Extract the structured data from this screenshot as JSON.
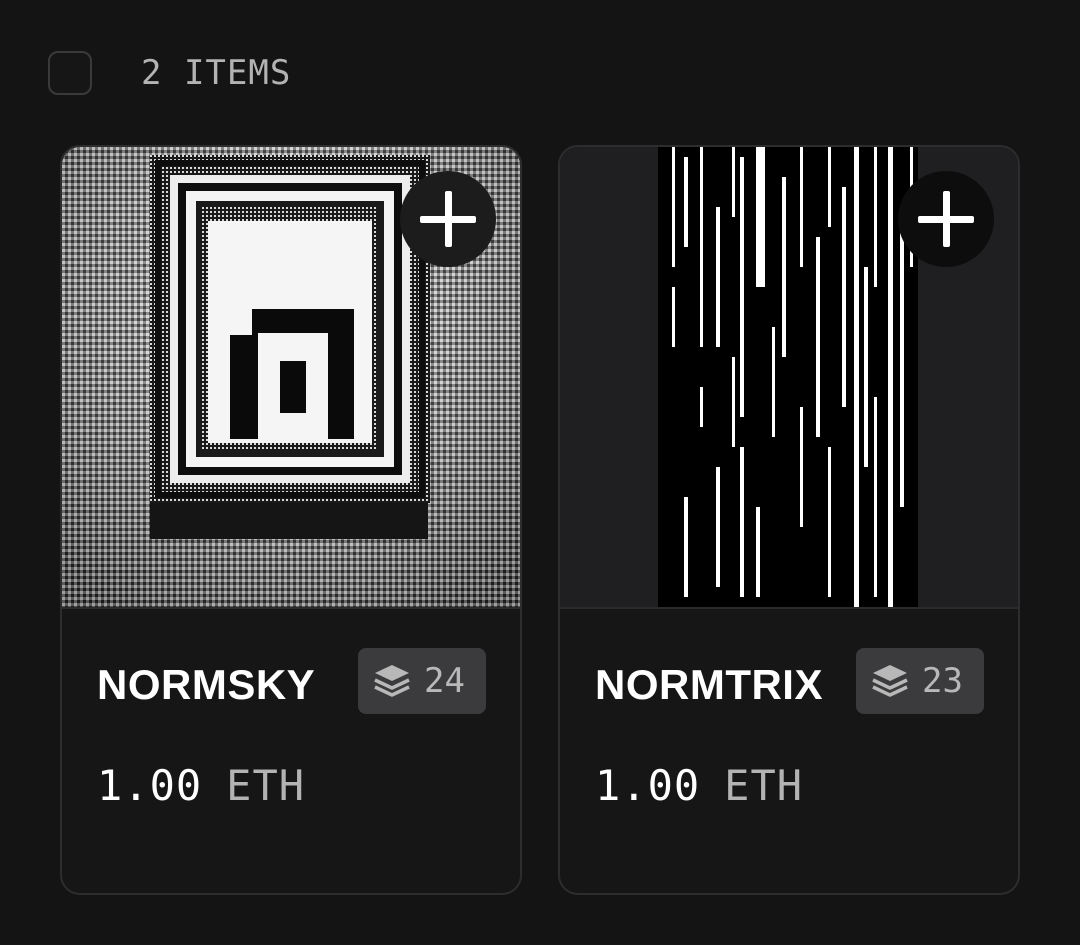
{
  "header": {
    "item_count": "2 ITEMS"
  },
  "items": [
    {
      "name": "NORMSKY",
      "layers": "24",
      "price": "1.00",
      "currency": "ETH"
    },
    {
      "name": "NORMTRIX",
      "layers": "23",
      "price": "1.00",
      "currency": "ETH"
    }
  ],
  "icons": {
    "add": "plus-icon",
    "layers": "layers-icon"
  }
}
